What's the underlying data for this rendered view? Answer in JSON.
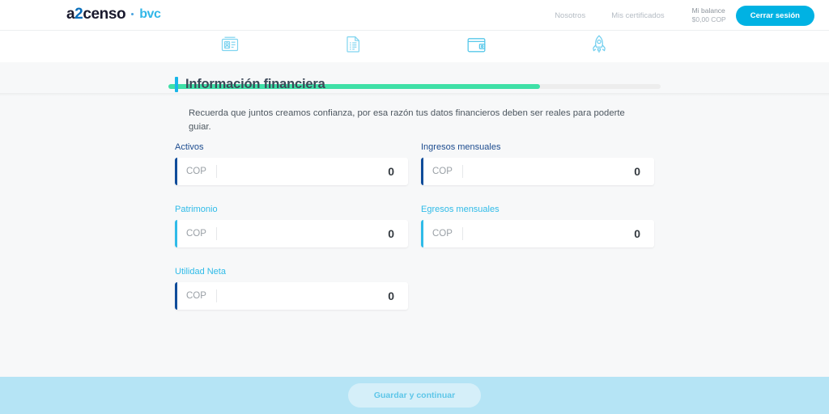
{
  "header": {
    "logo": {
      "primary": "a2cen",
      "primary_pre": "a",
      "accent": "2",
      "primary_post": "censo",
      "partner": "bvc"
    },
    "nav": [
      {
        "label": "Nosotros",
        "name": "nav-nosotros"
      },
      {
        "label": "Mis certificados",
        "name": "nav-mis-certificados"
      }
    ],
    "balance": {
      "label": "Mi balance",
      "value": "$0,00 COP"
    },
    "logout_label": "Cerrar sesión"
  },
  "stepper": {
    "tabs": [
      {
        "icon": "id-card-icon",
        "name": "tab-datos-personales"
      },
      {
        "icon": "document-icon",
        "name": "tab-documentos"
      },
      {
        "icon": "wallet-icon",
        "name": "tab-informacion-financiera"
      },
      {
        "icon": "rocket-icon",
        "name": "tab-finalizar"
      }
    ],
    "progress_percent": 75
  },
  "main": {
    "title": "Información financiera",
    "description": "Recuerda que juntos creamos confianza, por esa razón tus datos financieros deben ser reales para poderte guiar.",
    "fields": [
      {
        "label": "Activos",
        "currency": "COP",
        "value": "0",
        "label_color": "dark",
        "accent_color": "dark"
      },
      {
        "label": "Ingresos mensuales",
        "currency": "COP",
        "value": "0",
        "label_color": "dark",
        "accent_color": "dark"
      },
      {
        "label": "Patrimonio",
        "currency": "COP",
        "value": "0",
        "label_color": "cyan",
        "accent_color": "cyan"
      },
      {
        "label": "Egresos mensuales",
        "currency": "COP",
        "value": "0",
        "label_color": "cyan",
        "accent_color": "cyan"
      },
      {
        "label": "Utilidad Neta",
        "currency": "COP",
        "value": "0",
        "label_color": "cyan",
        "accent_color": "dark"
      }
    ]
  },
  "footer": {
    "save_label": "Guardar y continuar"
  },
  "colors": {
    "accent_cyan": "#00b2e3",
    "accent_dark_blue": "#0f4c9a",
    "progress_green": "#3ee0a7",
    "footer_bg": "#b5e4f5"
  }
}
